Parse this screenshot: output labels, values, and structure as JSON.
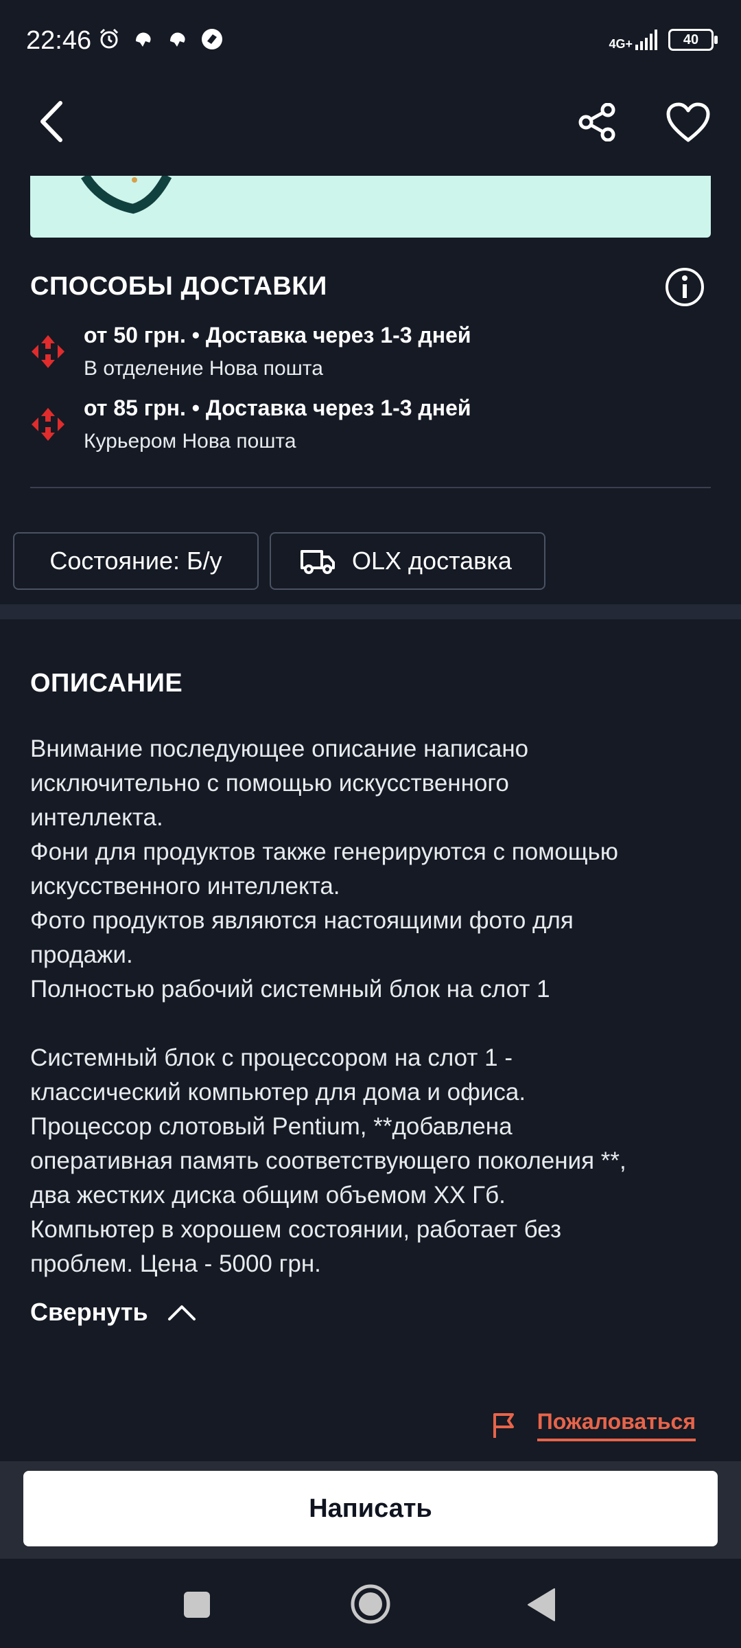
{
  "status_bar": {
    "time": "22:46",
    "network": "4G+",
    "battery": "40"
  },
  "top_bar": {
    "back_icon": "chevron-left-icon",
    "share_icon": "share-icon",
    "favorite_icon": "heart-icon"
  },
  "delivery": {
    "title": "СПОСОБЫ ДОСТАВКИ",
    "info_icon": "info-icon",
    "options": [
      {
        "main": "от 50 грн. • Доставка через 1-3 дней",
        "sub": "В отделение Нова пошта"
      },
      {
        "main": "от 85 грн. • Доставка через 1-3 дней",
        "sub": "Курьером Нова пошта"
      }
    ]
  },
  "chips": {
    "condition": "Состояние: Б/у",
    "olx_delivery": "OLX доставка"
  },
  "description": {
    "title": "ОПИСАНИЕ",
    "text": "Внимание последующее описание написано\nисключительно с помощью искусственного\nинтеллекта.\nФони для продуктов также генерируются с помощью\nискусственного интеллекта.\nФото продуктов являются настоящими фото для\nпродажи.\nПолностью рабочий системный блок на слот 1\n\nСистемный блок с процессором на слот 1 -\nклассический компьютер для дома и офиса.\nПроцессор слотовый Pentium, **добавлена\nоперативная память соответствующего поколения **,\nдва жестких диска общим объемом XX Гб.\nКомпьютер в хорошем состоянии, работает без\nпроблем. Цена - 5000 грн.",
    "collapse": "Свернуть"
  },
  "report": {
    "label": "Пожаловаться"
  },
  "actions": {
    "write": "Написать"
  },
  "colors": {
    "background": "#151a24",
    "accent_red": "#e8644a",
    "nova_poshta_red": "#e02c2c",
    "image_bg": "#cdf5ec"
  }
}
